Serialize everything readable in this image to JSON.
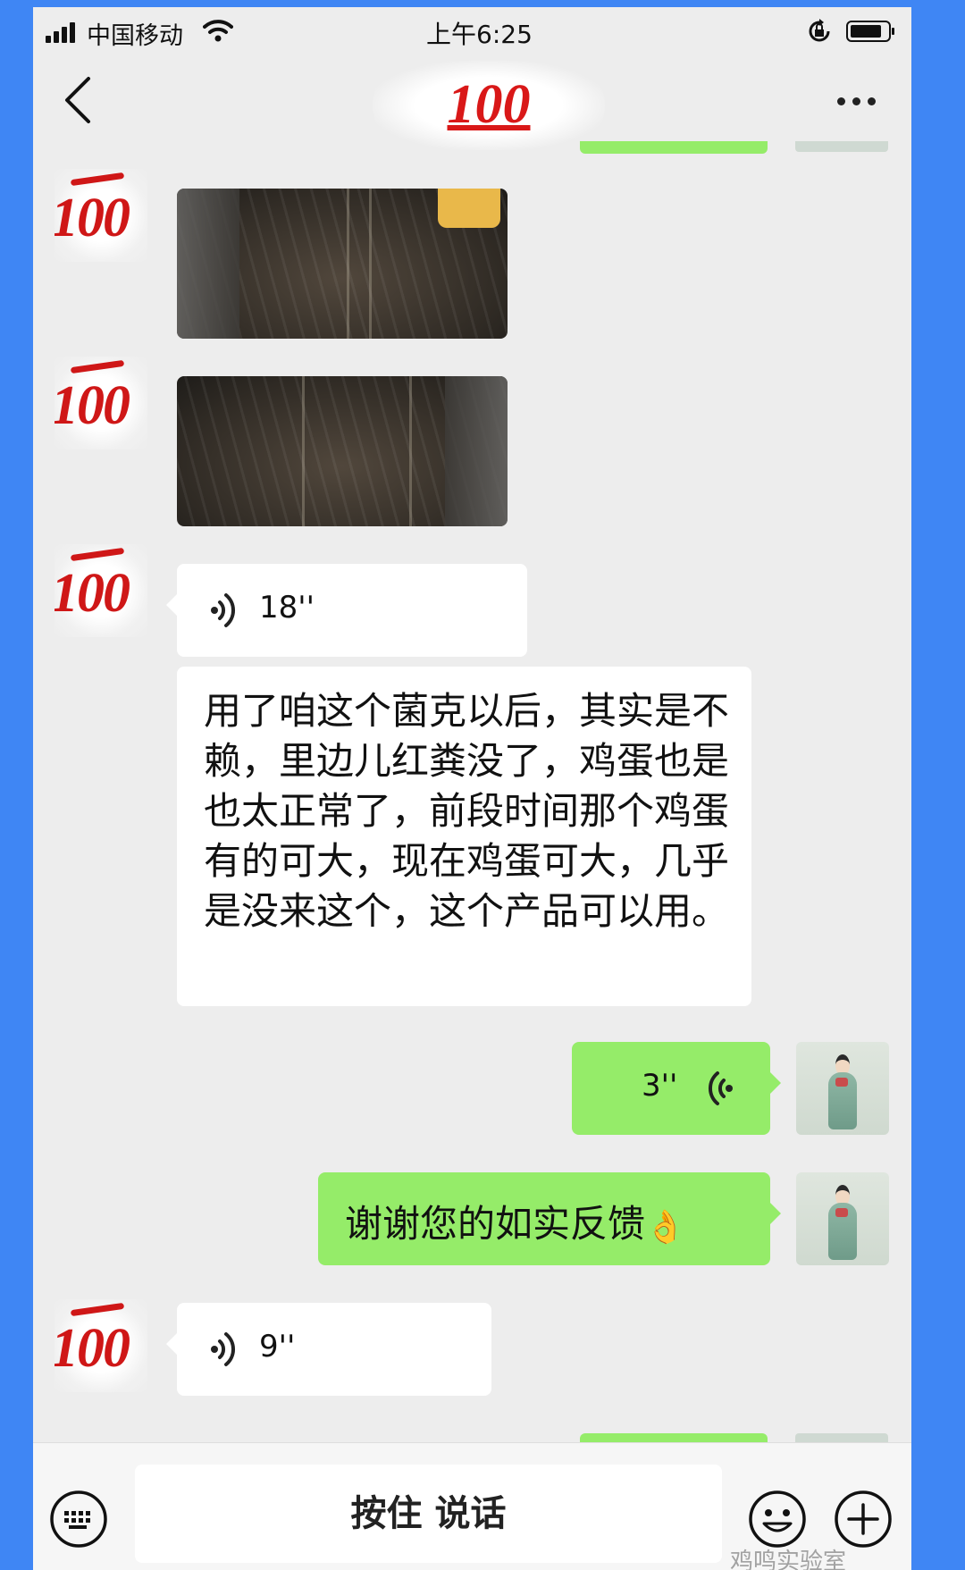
{
  "status_bar": {
    "carrier": "中国移动",
    "time": "上午6:25",
    "battery_level": 0.85
  },
  "nav": {
    "title": "100"
  },
  "avatars": {
    "contact_mark": "100"
  },
  "messages": {
    "voice1": "18''",
    "text": "用了咱这个菌克以后，其实是不赖，里边儿红粪没了，鸡蛋也是也太正常了，前段时间那个鸡蛋有的可大，现在鸡蛋可大，几乎是没来这个，这个产品可以用。",
    "voice_sent": "3''",
    "thanks": "谢谢您的如实反馈",
    "voice2": "9''"
  },
  "input_bar": {
    "hold_to_talk": "按住 说话"
  },
  "watermark": "鸡鸣实验室",
  "colors": {
    "background": "#3f86f4",
    "chat_background": "#ededed",
    "sent_bubble": "#95ec69",
    "received_bubble": "#ffffff"
  }
}
